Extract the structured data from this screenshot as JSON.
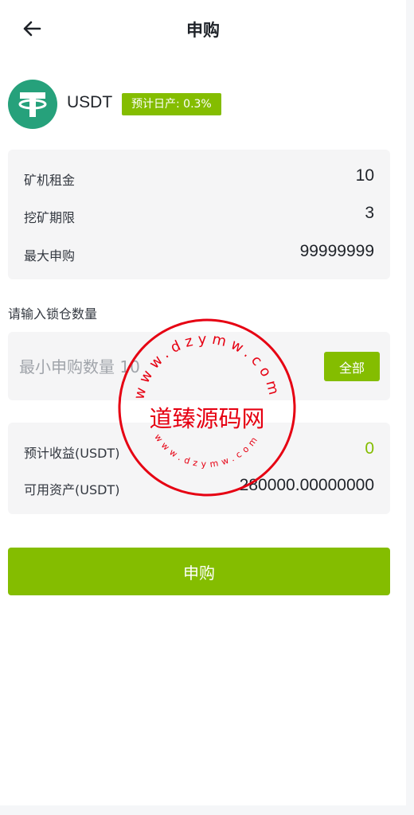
{
  "header": {
    "title": "申购",
    "back_icon": "arrow-left-icon"
  },
  "coin": {
    "icon": "tether-icon",
    "name": "USDT",
    "yield_badge": "预计日产: 0.3%"
  },
  "rent_card": {
    "rows": [
      {
        "label": "矿机租金",
        "value": "10"
      },
      {
        "label": "挖矿期限",
        "value": "3"
      },
      {
        "label": "最大申购",
        "value": "99999999"
      }
    ]
  },
  "lock_section": {
    "label": "请输入锁仓数量",
    "input_value": "",
    "input_placeholder": "最小申购数量 10",
    "all_button": "全部"
  },
  "income_card": {
    "rows": [
      {
        "label": "预计收益(USDT)",
        "value": "0"
      },
      {
        "label": "可用资产(USDT)",
        "value": "280000.00000000"
      }
    ]
  },
  "submit_button": "申购",
  "watermark": {
    "text": "道臻源码网",
    "ring_text": "www.dzymw.com",
    "color": "#e60012"
  },
  "colors": {
    "accent": "#84bd00",
    "tether": "#26a17b",
    "card_bg": "#f5f5f6"
  }
}
